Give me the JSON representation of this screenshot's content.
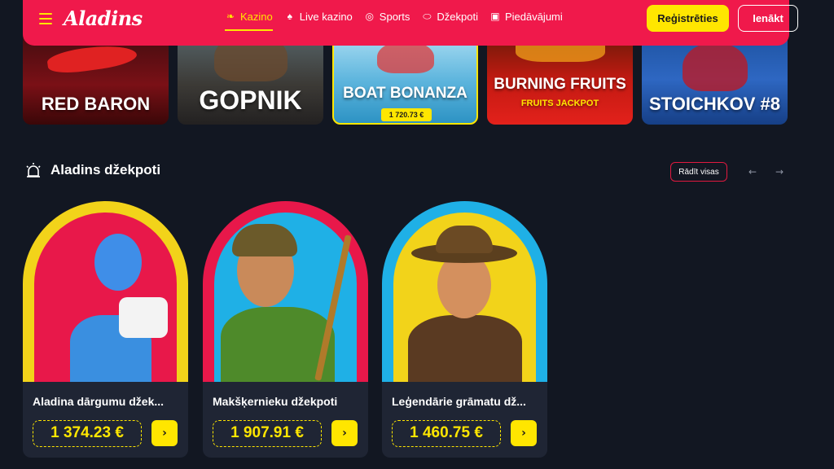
{
  "header": {
    "logo": "Aladins",
    "nav": [
      {
        "label": "Kazino",
        "icon": "lamp-icon",
        "active": true
      },
      {
        "label": "Live kazino",
        "icon": "cards-icon",
        "active": false
      },
      {
        "label": "Sports",
        "icon": "ball-icon",
        "active": false
      },
      {
        "label": "Džekpoti",
        "icon": "money-bag-icon",
        "active": false
      },
      {
        "label": "Piedāvājumi",
        "icon": "gift-icon",
        "active": false
      }
    ],
    "register_label": "Reģistrēties",
    "login_label": "Ienākt"
  },
  "games": [
    {
      "title": "RED BARON"
    },
    {
      "title": "GOPNIK"
    },
    {
      "title": "BOAT BONANZA",
      "jackpot": "1 720.73 €"
    },
    {
      "title": "BURNING FRUITS",
      "subtitle": "FRUITS JACKPOT"
    },
    {
      "title": "STOICHKOV #8"
    }
  ],
  "jackpots": {
    "title": "Aladins džekpoti",
    "show_all_label": "Rādīt visas",
    "cards": [
      {
        "name": "Aladina dārgumu džek...",
        "amount": "1 374.23 €"
      },
      {
        "name": "Makšķernieku džekpoti",
        "amount": "1 907.91 €"
      },
      {
        "name": "Leģendārie grāmatu dž...",
        "amount": "1 460.75 €"
      }
    ]
  },
  "colors": {
    "background": "#121722",
    "header": "#f0194b",
    "accent": "#ffe600",
    "card": "#1f2534"
  }
}
